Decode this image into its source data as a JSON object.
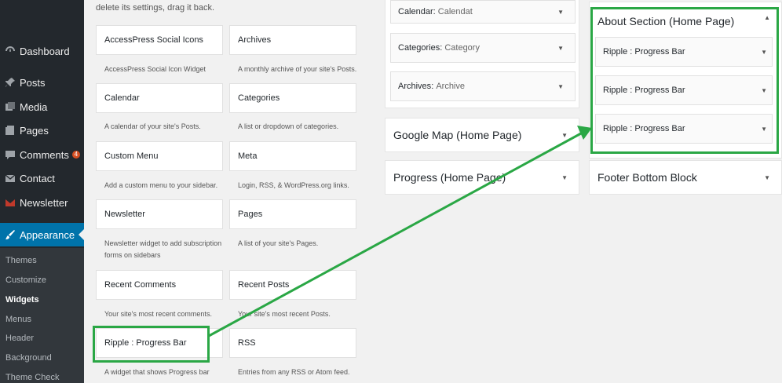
{
  "menu": {
    "dashboard": "Dashboard",
    "posts": "Posts",
    "media": "Media",
    "pages": "Pages",
    "comments": "Comments",
    "comments_badge": "4",
    "contact": "Contact",
    "newsletter": "Newsletter",
    "appearance": "Appearance"
  },
  "submenu": {
    "themes": "Themes",
    "customize": "Customize",
    "widgets": "Widgets",
    "menus": "Menus",
    "header": "Header",
    "background": "Background",
    "theme_check": "Theme Check"
  },
  "available": {
    "intro": "delete its settings, drag it back.",
    "widgets": [
      {
        "title": "AccessPress Social Icons",
        "desc": "AccessPress Social Icon Widget"
      },
      {
        "title": "Archives",
        "desc": "A monthly archive of your site's Posts."
      },
      {
        "title": "Calendar",
        "desc": "A calendar of your site's Posts."
      },
      {
        "title": "Categories",
        "desc": "A list or dropdown of categories."
      },
      {
        "title": "Custom Menu",
        "desc": "Add a custom menu to your sidebar."
      },
      {
        "title": "Meta",
        "desc": "Login, RSS, & WordPress.org links."
      },
      {
        "title": "Newsletter",
        "desc": "Newsletter widget to add subscription forms on sidebars"
      },
      {
        "title": "Pages",
        "desc": "A list of your site's Pages."
      },
      {
        "title": "Recent Comments",
        "desc": "Your site's most recent comments."
      },
      {
        "title": "Recent Posts",
        "desc": "Your site's most recent Posts."
      },
      {
        "title": "Ripple : Progress Bar",
        "desc": "A widget that shows Progress bar"
      },
      {
        "title": "RSS",
        "desc": "Entries from any RSS or Atom feed."
      }
    ]
  },
  "sidebar_widgets": {
    "calendar": {
      "name": "Calendar",
      "sub": "Calendat"
    },
    "categories": {
      "name": "Categories",
      "sub": "Category"
    },
    "archives": {
      "name": "Archives",
      "sub": "Archive"
    }
  },
  "areas": {
    "google_map": "Google Map (Home Page)",
    "progress": "Progress (Home Page)",
    "about": "About Section (Home Page)",
    "footer_bottom": "Footer Bottom Block"
  },
  "about_widgets": [
    "Ripple : Progress Bar",
    "Ripple : Progress Bar",
    "Ripple : Progress Bar"
  ],
  "separator": ": ",
  "icons": {
    "collapse": "▼",
    "expand": "▲"
  },
  "colors": {
    "accent": "#0073aa",
    "highlight": "#2aa745",
    "sidebar_bg": "#23282d"
  }
}
